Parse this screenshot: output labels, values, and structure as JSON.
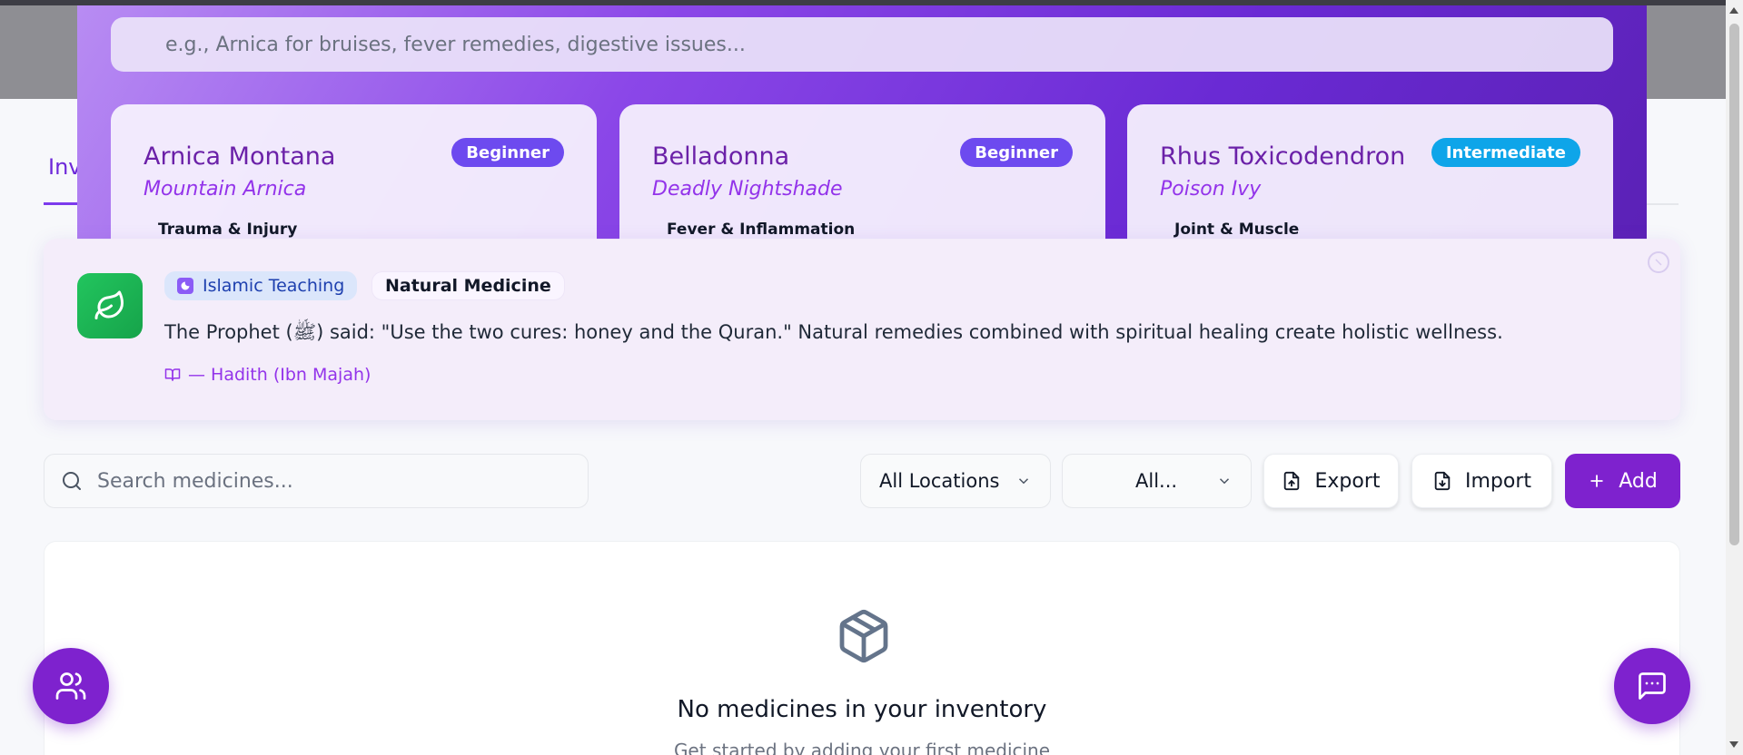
{
  "background": {
    "tab_partial": "Inv"
  },
  "remedy_finder": {
    "search_placeholder": "e.g., Arnica for bruises, fever remedies, digestive issues...",
    "cards": [
      {
        "name": "Arnica Montana",
        "common_name": "Mountain Arnica",
        "level": "Beginner",
        "category": "Trauma & Injury",
        "badge_color": "#6d4aef"
      },
      {
        "name": "Belladonna",
        "common_name": "Deadly Nightshade",
        "level": "Beginner",
        "category": "Fever & Inflammation",
        "badge_color": "#6d4aef"
      },
      {
        "name": "Rhus Toxicodendron",
        "common_name": "Poison Ivy",
        "level": "Intermediate",
        "category": "Joint & Muscle",
        "badge_color": "#0ea5e9"
      }
    ]
  },
  "teaching": {
    "tag_primary": "Islamic Teaching",
    "tag_secondary": "Natural Medicine",
    "quote": "The Prophet (ﷺ) said: \"Use the two cures: honey and the Quran.\" Natural remedies combined with spiritual healing create holistic wellness.",
    "source": "— Hadith (Ibn Majah)"
  },
  "toolbar": {
    "search_placeholder": "Search medicines...",
    "location_filter": "All Locations",
    "category_filter": "All...",
    "export_label": "Export",
    "import_label": "Import",
    "add_label": "Add"
  },
  "empty_state": {
    "title": "No medicines in your inventory",
    "subtitle": "Get started by adding your first medicine"
  },
  "colors": {
    "primary": "#7e22ce",
    "accent_green": "#22c55e"
  }
}
